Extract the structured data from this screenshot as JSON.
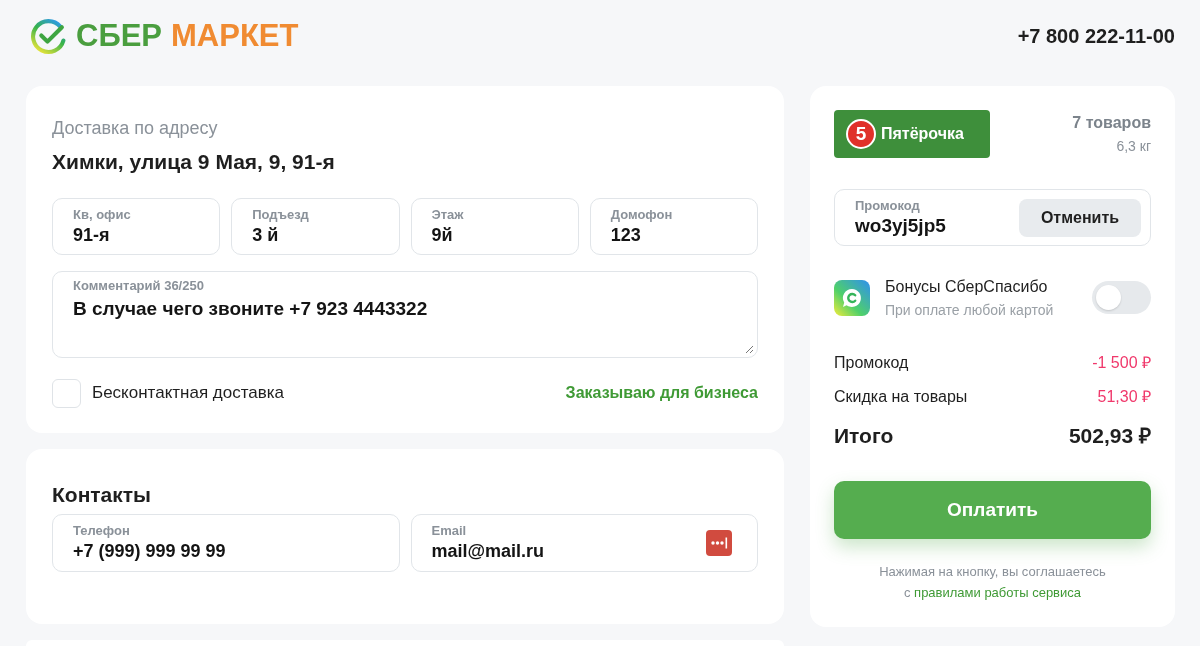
{
  "header": {
    "logo": {
      "primary": "СБЕР",
      "secondary": "МАРКЕТ"
    },
    "phone": "+7 800 222-11-00"
  },
  "delivery": {
    "title": "Доставка по адресу",
    "address": "Химки, улица 9 Мая, 9, 91-я",
    "fields": [
      {
        "label": "Кв, офис",
        "value": "91-я"
      },
      {
        "label": "Подъезд",
        "value": "3 й"
      },
      {
        "label": "Этаж",
        "value": "9й"
      },
      {
        "label": "Домофон",
        "value": "123"
      }
    ],
    "comment": {
      "label": "Комментарий 36/250",
      "value": "В случае чего звоните +7 923 4443322"
    },
    "contactless": {
      "label": "Бесконтактная доставка",
      "checked": false
    },
    "business_link": "Заказываю для бизнеса"
  },
  "contacts": {
    "title": "Контакты",
    "fields": [
      {
        "kind": "phone",
        "label": "Телефон",
        "value": "+7 (999) 999 99 99"
      },
      {
        "kind": "email",
        "label": "Email",
        "value": "mail@mail.ru"
      }
    ]
  },
  "order": {
    "store": {
      "logo_digit": "5",
      "logo_text": "Пятёрочка"
    },
    "items_count": "7 товаров",
    "weight": "6,3 кг",
    "promo": {
      "label": "Промокод",
      "value": "wo3yj5jp5",
      "button": "Отменить"
    },
    "bonus": {
      "title": "Бонусы СберСпасибо",
      "subtitle": "При оплате любой картой",
      "on": false
    },
    "summary": [
      {
        "kind": "discount",
        "label": "Промокод",
        "value": "-1 500 ₽"
      },
      {
        "kind": "discount",
        "label": "Скидка на товары",
        "value": "51,30 ₽"
      },
      {
        "kind": "total",
        "label": "Итого",
        "value": "502,93 ₽"
      }
    ],
    "pay_button": "Оплатить",
    "agreement": {
      "text": "Нажимая на кнопку, вы соглашаетесь",
      "link_prefix": "с",
      "link": "правилами работы сервиса"
    }
  }
}
